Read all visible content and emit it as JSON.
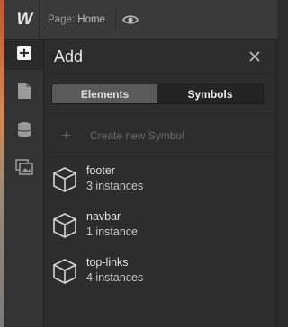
{
  "topbar": {
    "logo": "W",
    "page_key": "Page:",
    "page_name": "Home"
  },
  "sidebar": {
    "items": [
      {
        "name": "add",
        "icon": "plus-square-icon",
        "active": true
      },
      {
        "name": "pages",
        "icon": "page-icon"
      },
      {
        "name": "cms",
        "icon": "database-icon"
      },
      {
        "name": "assets",
        "icon": "images-icon"
      }
    ]
  },
  "panel": {
    "title": "Add",
    "tabs": [
      {
        "label": "Elements",
        "active": false
      },
      {
        "label": "Symbols",
        "active": true
      }
    ],
    "create_label": "Create new Symbol",
    "create_plus": "+",
    "symbols": [
      {
        "name": "footer",
        "count": "3 instances"
      },
      {
        "name": "navbar",
        "count": "1 instance"
      },
      {
        "name": "top-links",
        "count": "4 instances"
      }
    ]
  },
  "colors": {
    "background": "#2d2d2d",
    "topbar": "#3a3a3a",
    "tab_inactive": "#5a5a5a",
    "tab_active": "#242424"
  }
}
